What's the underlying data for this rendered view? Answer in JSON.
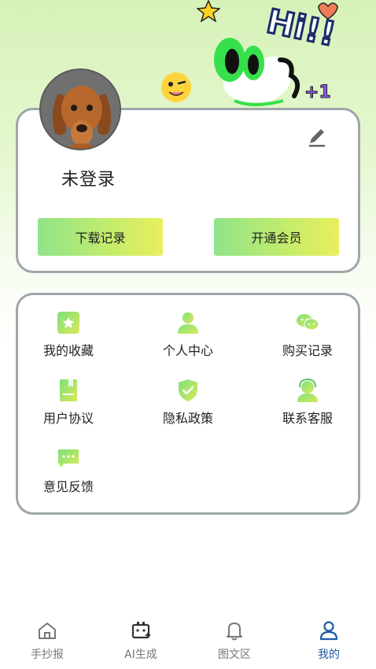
{
  "profile": {
    "login_status": "未登录",
    "buttons": {
      "download_records": "下载记录",
      "open_vip": "开通会员"
    }
  },
  "decorations": {
    "hi_text": "Hi!!",
    "plus_one": "+1"
  },
  "menu": {
    "items": [
      {
        "label": "我的收藏",
        "icon": "favorites-icon"
      },
      {
        "label": "个人中心",
        "icon": "user-icon"
      },
      {
        "label": "购买记录",
        "icon": "chat-icon"
      },
      {
        "label": "用户协议",
        "icon": "document-icon"
      },
      {
        "label": "隐私政策",
        "icon": "shield-icon"
      },
      {
        "label": "联系客服",
        "icon": "customer-service-icon"
      },
      {
        "label": "意见反馈",
        "icon": "feedback-icon"
      }
    ]
  },
  "tabbar": {
    "tabs": [
      {
        "label": "手抄报",
        "icon": "home-icon"
      },
      {
        "label": "AI生成",
        "icon": "ai-icon"
      },
      {
        "label": "图文区",
        "icon": "bell-icon"
      },
      {
        "label": "我的",
        "icon": "profile-icon"
      }
    ],
    "active_index": 3
  },
  "colors": {
    "accent_green": "#8fe48a",
    "accent_yellow": "#e8ef5e",
    "active_tab": "#1d5aa8",
    "card_border": "#9ea6ab"
  }
}
